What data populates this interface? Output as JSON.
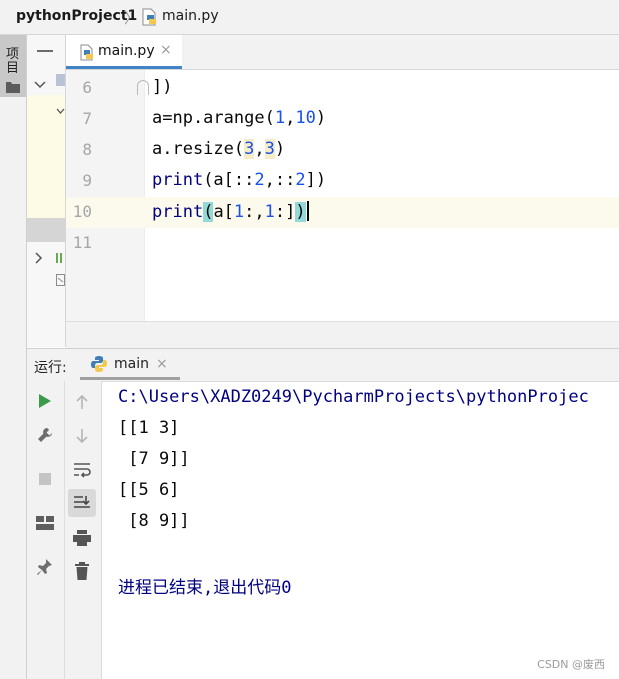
{
  "breadcrumb": {
    "project": "pythonProject1",
    "separator": "〉",
    "file": "main.py",
    "file_icon": "python-file-icon"
  },
  "left_strip": {
    "project_tab_label": "项目",
    "folder_icon": "folder-icon"
  },
  "editor": {
    "tab_label": "main.py",
    "tab_close": "×",
    "line_numbers": [
      "6",
      "7",
      "8",
      "9",
      "10",
      "11"
    ],
    "current_line": "10",
    "lines": {
      "l6": {
        "p1": "])"
      },
      "l7": {
        "p1": "a=np.arange(",
        "p2": "1",
        "p3": ",",
        "p4": "10",
        "p5": ")"
      },
      "l8": {
        "p1": "a.resize(",
        "p2": "3",
        "p3": ",",
        "p4": "3",
        "p5": ")"
      },
      "l9": {
        "p1": "print",
        "p2": "(a[::",
        "p3": "2",
        "p4": ",::",
        "p5": "2",
        "p6": "])"
      },
      "l10": {
        "p1": "print",
        "p2": "(",
        "p3": "a[",
        "p4": "1",
        "p5": ":,",
        "p6": "1",
        "p7": ":]",
        "p8": ")"
      }
    }
  },
  "run_panel": {
    "label": "运行:",
    "tab_label": "main",
    "tab_close": "×",
    "tool_icons": [
      "run-icon",
      "wrench-icon",
      "stop-icon",
      "layout-icon",
      "pin-icon"
    ],
    "nav_icons": [
      "arrow-up-icon",
      "arrow-down-icon",
      "soft-wrap-icon",
      "scroll-to-end-icon",
      "print-icon",
      "trash-icon"
    ],
    "console": {
      "path": "C:\\Users\\XADZ0249\\PycharmProjects\\pythonProjec",
      "lines": [
        "[[1 3]",
        " [7 9]]",
        "[[5 6]",
        " [8 9]]"
      ],
      "exit": "进程已结束,退出代码0"
    }
  },
  "watermark": "CSDN @废西",
  "colors": {
    "keyword": "#000080",
    "number": "#1750eb",
    "bracket_highlight": "#93d9d9",
    "console_path": "#000080",
    "run_green": "#3c9a4b"
  }
}
